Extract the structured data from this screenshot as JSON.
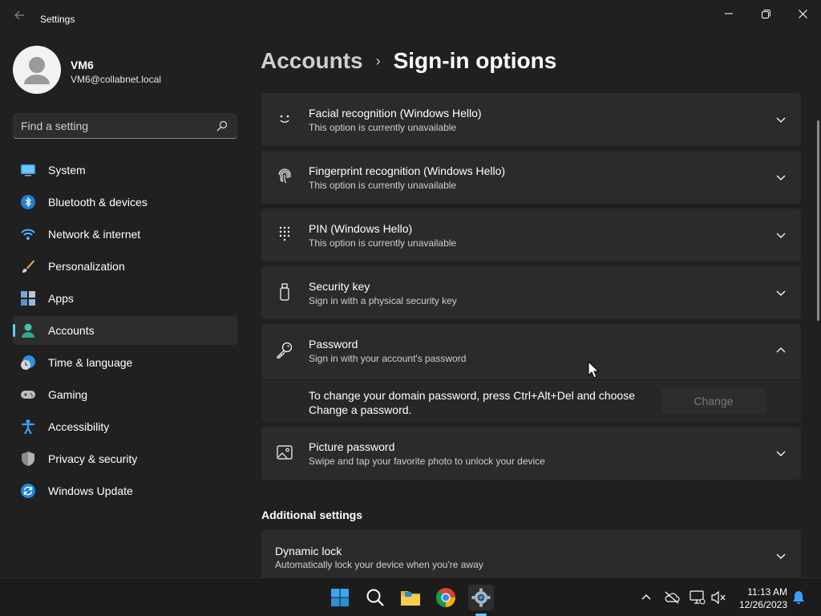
{
  "window": {
    "title": "Settings"
  },
  "user": {
    "name": "VM6",
    "email": "VM6@collabnet.local"
  },
  "search": {
    "placeholder": "Find a setting"
  },
  "sidebar": {
    "items": [
      {
        "label": "System",
        "icon": "monitor-icon"
      },
      {
        "label": "Bluetooth & devices",
        "icon": "bluetooth-icon"
      },
      {
        "label": "Network & internet",
        "icon": "wifi-icon"
      },
      {
        "label": "Personalization",
        "icon": "brush-icon"
      },
      {
        "label": "Apps",
        "icon": "apps-icon"
      },
      {
        "label": "Accounts",
        "icon": "person-icon",
        "active": true
      },
      {
        "label": "Time & language",
        "icon": "globe-clock-icon"
      },
      {
        "label": "Gaming",
        "icon": "gamepad-icon"
      },
      {
        "label": "Accessibility",
        "icon": "accessibility-icon"
      },
      {
        "label": "Privacy & security",
        "icon": "shield-icon"
      },
      {
        "label": "Windows Update",
        "icon": "sync-icon"
      }
    ]
  },
  "breadcrumb": {
    "parent": "Accounts",
    "separator": "›",
    "current": "Sign-in options"
  },
  "options": [
    {
      "title": "Facial recognition (Windows Hello)",
      "subtitle": "This option is currently unavailable",
      "icon": "face-icon",
      "expanded": false
    },
    {
      "title": "Fingerprint recognition (Windows Hello)",
      "subtitle": "This option is currently unavailable",
      "icon": "fingerprint-icon",
      "expanded": false
    },
    {
      "title": "PIN (Windows Hello)",
      "subtitle": "This option is currently unavailable",
      "icon": "keypad-icon",
      "expanded": false
    },
    {
      "title": "Security key",
      "subtitle": "Sign in with a physical security key",
      "icon": "usb-key-icon",
      "expanded": false
    },
    {
      "title": "Password",
      "subtitle": "Sign in with your account's password",
      "icon": "key-icon",
      "expanded": true
    },
    {
      "title": "Picture password",
      "subtitle": "Swipe and tap your favorite photo to unlock your device",
      "icon": "picture-icon",
      "expanded": false
    }
  ],
  "password_panel": {
    "text": "To change your domain password, press Ctrl+Alt+Del and choose Change a password.",
    "button": "Change"
  },
  "additional": {
    "heading": "Additional settings",
    "items": [
      {
        "title": "Dynamic lock",
        "subtitle": "Automatically lock your device when you're away"
      }
    ]
  },
  "taskbar": {
    "apps": [
      "windows-start-icon",
      "search-icon",
      "file-explorer-icon",
      "chrome-icon",
      "settings-gear-icon"
    ],
    "clock": {
      "time": "11:13 AM",
      "date": "12/26/2023"
    }
  },
  "colors": {
    "accent": "#60cdff",
    "background": "#202020",
    "card": "#2b2b2b"
  }
}
